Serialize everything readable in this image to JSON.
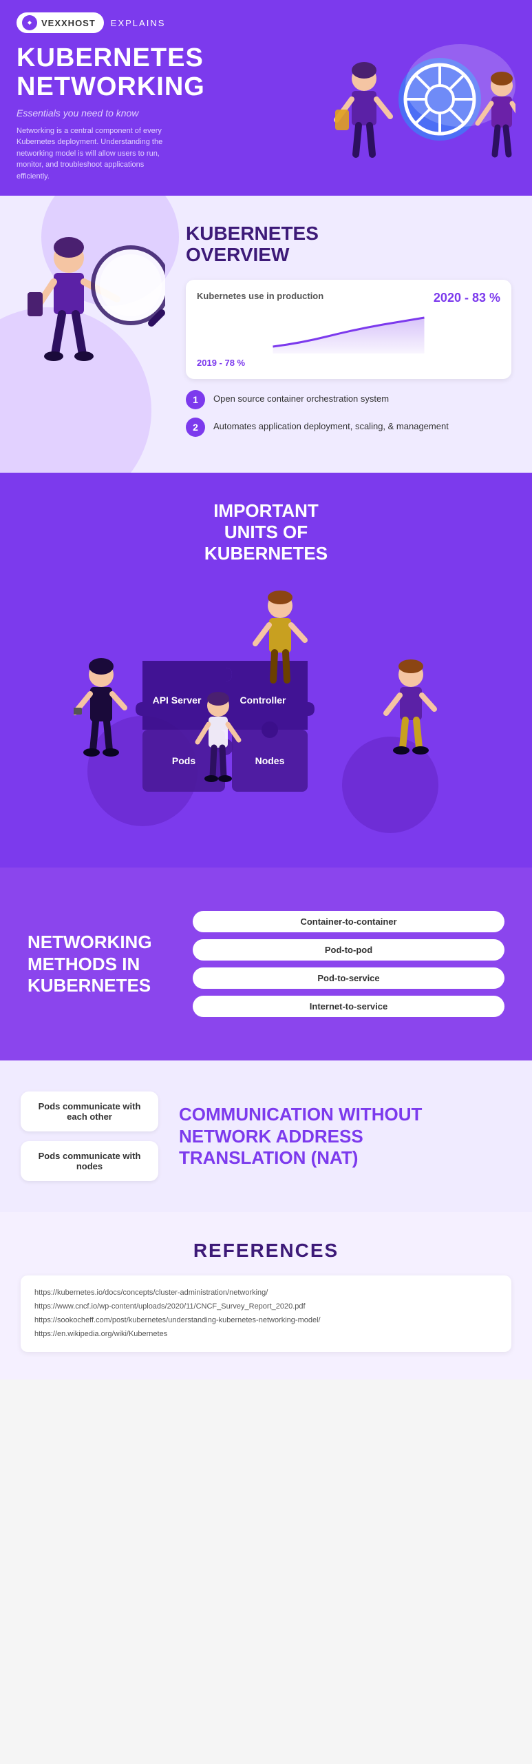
{
  "header": {
    "logo_text": "VEXXHOST",
    "explains_text": "EXPLAINS",
    "main_title": "KUBERNETES\nNETWORKING",
    "subtitle": "Essentials you need to know",
    "description": "Networking is a central component of every Kubernetes deployment. Understanding the networking model is will allow users to run, monitor, and troubleshoot applications efficiently."
  },
  "overview": {
    "title": "KUBERNETES\nOVERVIEW",
    "chart_label": "Kubernetes use in production",
    "value_2020": "2020 - 83 %",
    "value_2019": "2019 - 78 %",
    "items": [
      {
        "number": "1",
        "text": "Open source container orchestration system"
      },
      {
        "number": "2",
        "text": "Automates application deployment, scaling, & management"
      }
    ]
  },
  "units": {
    "title": "IMPORTANT\nUNITS OF\nKUBERNETES",
    "puzzle_pieces": [
      "API Server",
      "Controller",
      "Pods",
      "Nodes"
    ]
  },
  "networking": {
    "title": "NETWORKING\nMETHODS IN\nKUBERNETES",
    "methods": [
      "Container-to-container",
      "Pod-to-pod",
      "Pod-to-service",
      "Internet-to-service"
    ]
  },
  "communication": {
    "items": [
      "Pods communicate with each other",
      "Pods communicate with nodes"
    ],
    "title_line1": "COMMUNICATION WITHOUT",
    "title_line2": "NETWORK ADDRESS",
    "title_line3": "TRANSLATION",
    "title_nat": "(NAT)"
  },
  "references": {
    "title": "REFERENCES",
    "links": [
      "https://kubernetes.io/docs/concepts/cluster-administration/networking/",
      "https://www.cncf.io/wp-content/uploads/2020/11/CNCF_Survey_Report_2020.pdf",
      "https://sookocheff.com/post/kubernetes/understanding-kubernetes-networking-model/",
      "https://en.wikipedia.org/wiki/Kubernetes"
    ]
  }
}
